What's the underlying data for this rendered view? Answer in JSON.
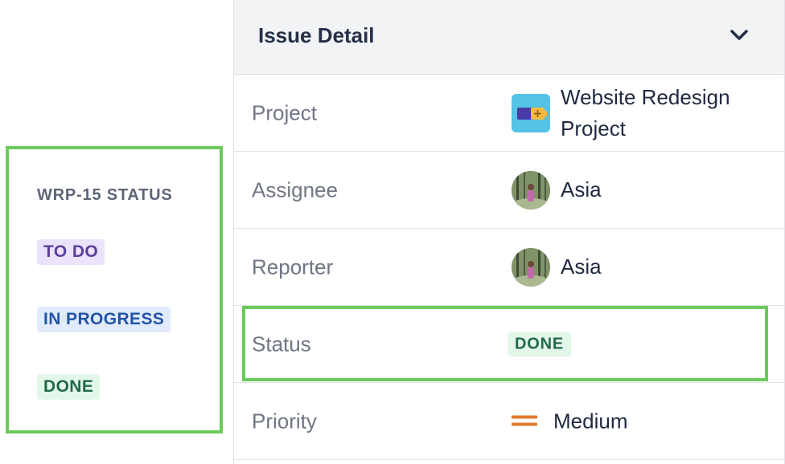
{
  "legend": {
    "heading": "WRP-15 STATUS",
    "statuses": [
      {
        "label": "TO DO",
        "color": "#5b3f9e",
        "background": "#ebe3fb"
      },
      {
        "label": "IN PROGRESS",
        "color": "#2254a6",
        "background": "#e1ebfb"
      },
      {
        "label": "DONE",
        "color": "#226a44",
        "background": "#e3f6ea"
      }
    ]
  },
  "panel": {
    "title": "Issue Detail",
    "collapse_icon": "chevron-down-icon",
    "fields": {
      "project": {
        "label": "Project",
        "value_line1": "Website Redesign",
        "value_line2": "Project",
        "icon": "project-icon"
      },
      "assignee": {
        "label": "Assignee",
        "value": "Asia",
        "icon": "avatar"
      },
      "reporter": {
        "label": "Reporter",
        "value": "Asia",
        "icon": "avatar"
      },
      "status": {
        "label": "Status",
        "value": "DONE"
      },
      "priority": {
        "label": "Priority",
        "value": "Medium",
        "icon": "priority-medium-icon",
        "icon_color": "#e07a2f"
      }
    }
  },
  "colors": {
    "highlight": "#6cc95c",
    "header_bg": "#f2f3f5",
    "text_primary": "#1f2941",
    "text_secondary": "#707685"
  }
}
